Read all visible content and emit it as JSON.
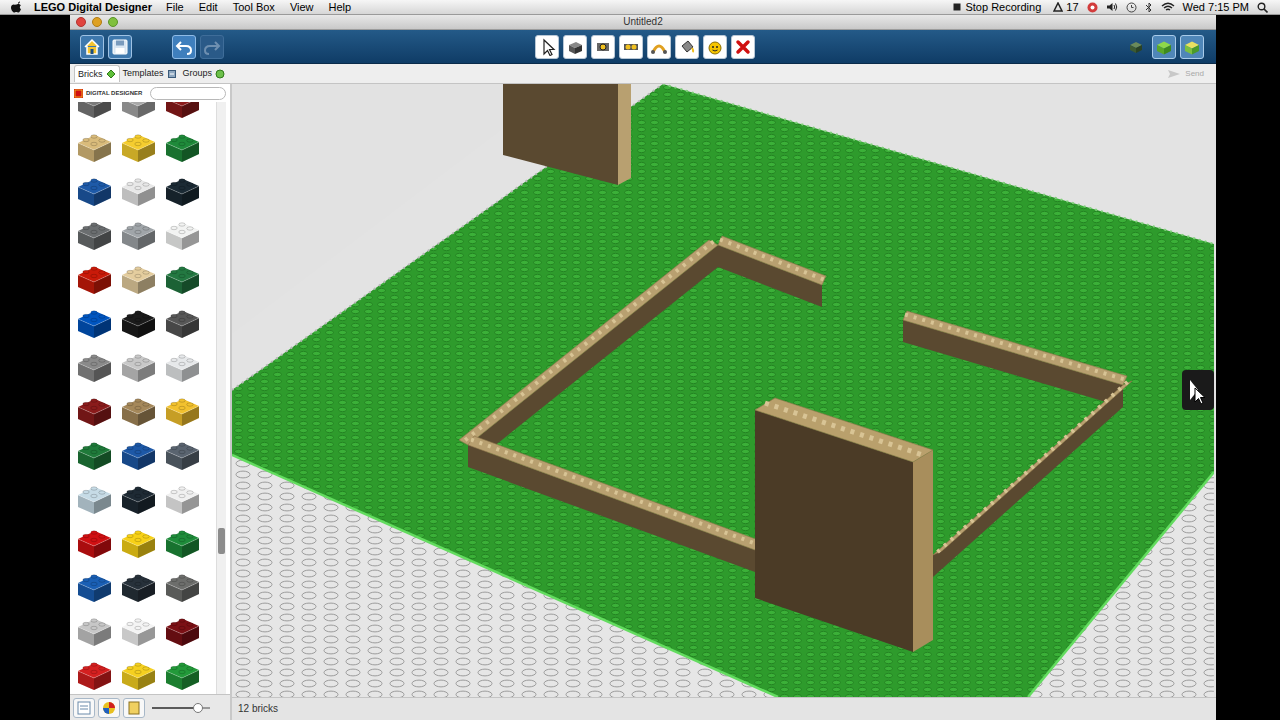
{
  "menubar": {
    "app": "LEGO Digital Designer",
    "menus": [
      "File",
      "Edit",
      "Tool Box",
      "View",
      "Help"
    ],
    "recording": "Stop Recording",
    "badge": "17",
    "clock": "Wed 7:15 PM"
  },
  "window": {
    "title": "Untitled2"
  },
  "tabs": [
    {
      "label": "Bricks",
      "selected": true
    },
    {
      "label": "Templates",
      "selected": false
    },
    {
      "label": "Groups",
      "selected": false
    }
  ],
  "send": {
    "label": "Send",
    "disabled": true
  },
  "palette": {
    "logo": "DIGITAL DESIGNER",
    "bricks": [
      {
        "color": "#7a7a7a"
      },
      {
        "color": "#a8a8a8"
      },
      {
        "color": "#8b1a1a"
      },
      {
        "color": "#d9bb7b"
      },
      {
        "color": "#f5cd2f"
      },
      {
        "color": "#1f8a3a"
      },
      {
        "color": "#1e5aa8"
      },
      {
        "color": "#e8e8e8"
      },
      {
        "color": "#1b2a34"
      },
      {
        "color": "#6b6e70"
      },
      {
        "color": "#a0a5a9"
      },
      {
        "color": "#f2f3f2"
      },
      {
        "color": "#c91a09"
      },
      {
        "color": "#e4cd9e"
      },
      {
        "color": "#237841"
      },
      {
        "color": "#0055bf"
      },
      {
        "color": "#1b1b1b"
      },
      {
        "color": "#575757"
      },
      {
        "color": "#8a8a8a"
      },
      {
        "color": "#c8c8c8"
      },
      {
        "color": "#e6e8ea"
      },
      {
        "color": "#8a1b1b"
      },
      {
        "color": "#a5885a"
      },
      {
        "color": "#f2c12e"
      },
      {
        "color": "#1f7a3a"
      },
      {
        "color": "#1d58a7"
      },
      {
        "color": "#5a6470"
      },
      {
        "color": "#c6dbe6"
      },
      {
        "color": "#1e2a34"
      },
      {
        "color": "#f0f0f0"
      },
      {
        "color": "#d01012"
      },
      {
        "color": "#f7d117"
      },
      {
        "color": "#1e8c3a"
      },
      {
        "color": "#1a5fb4"
      },
      {
        "color": "#27313a"
      },
      {
        "color": "#6d6e6c"
      },
      {
        "color": "#c7c7c7"
      },
      {
        "color": "#f4f4f4"
      },
      {
        "color": "#7b1015"
      },
      {
        "color": "#d42020"
      },
      {
        "color": "#f5d020"
      },
      {
        "color": "#239a3a"
      }
    ],
    "zoom": {
      "level": 0.8
    }
  },
  "status_bar": {
    "count": "12 bricks"
  }
}
